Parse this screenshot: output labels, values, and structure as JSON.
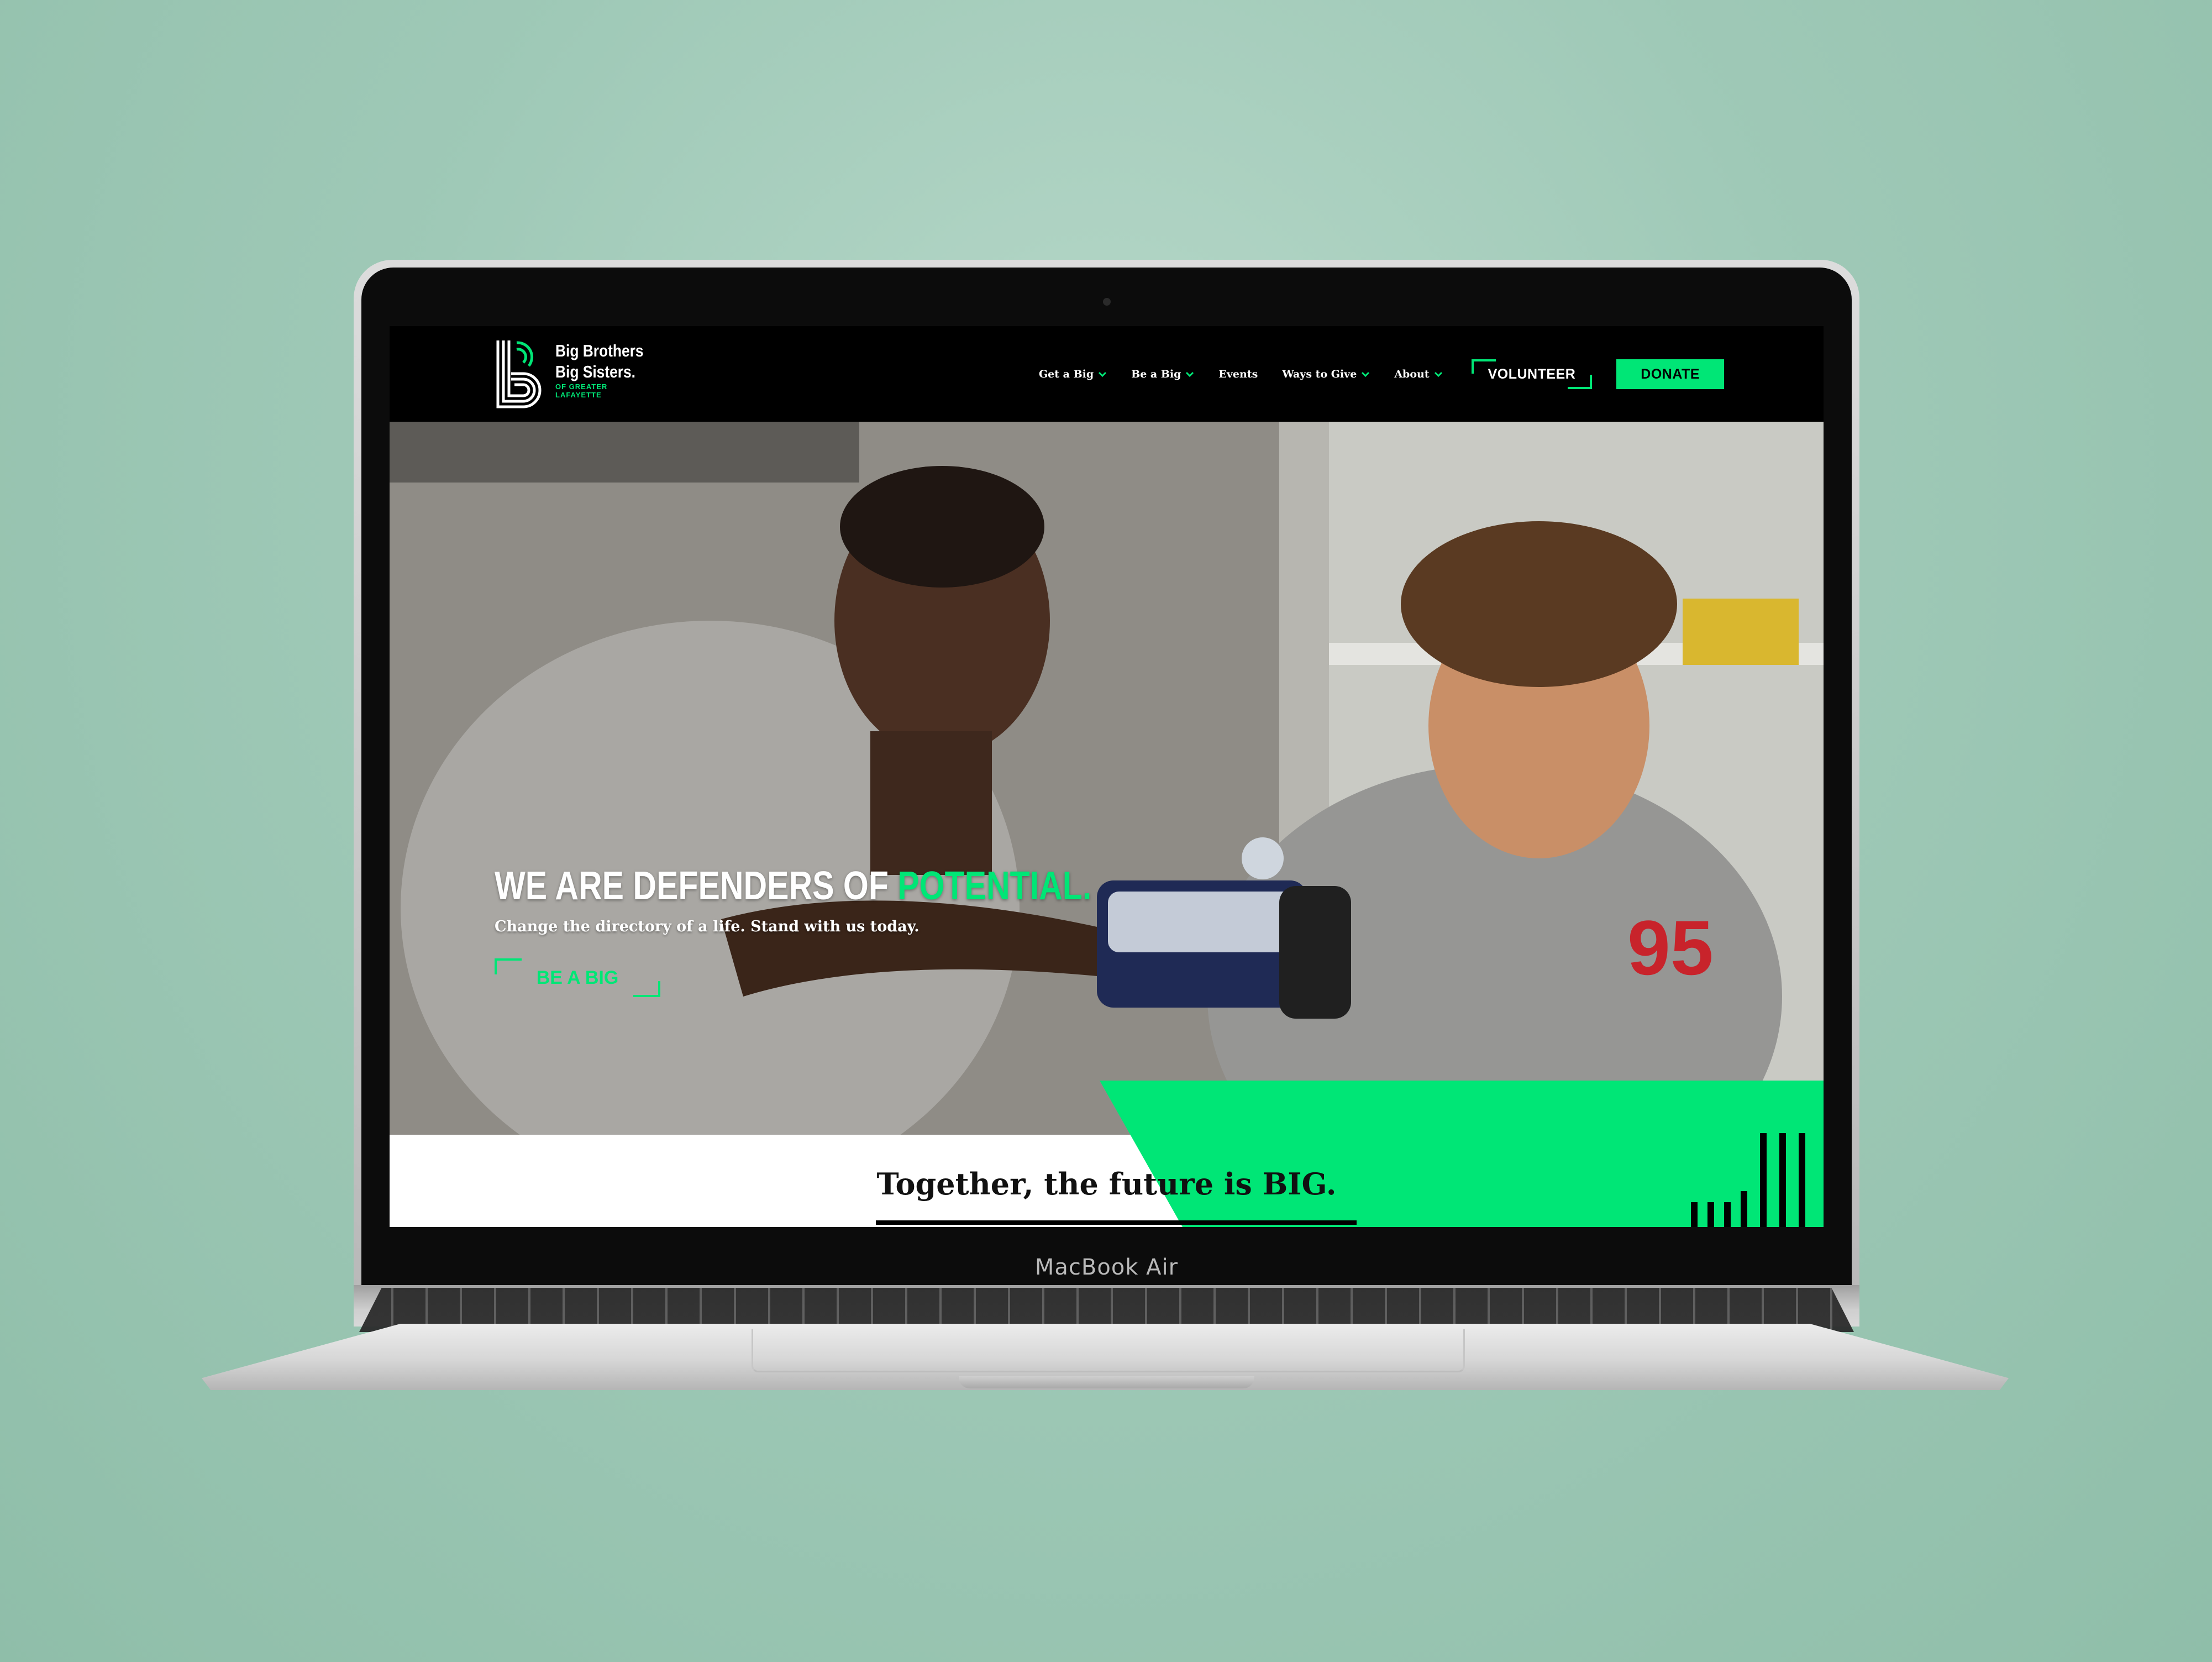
{
  "device": {
    "label": "MacBook Air"
  },
  "site": {
    "logo": {
      "line1": "Big Brothers",
      "line2": "Big Sisters.",
      "sub1": "OF GREATER",
      "sub2": "LAFAYETTE"
    },
    "nav": {
      "items": [
        {
          "label": "Get a Big",
          "has_dropdown": true
        },
        {
          "label": "Be a Big",
          "has_dropdown": true
        },
        {
          "label": "Events",
          "has_dropdown": false
        },
        {
          "label": "Ways to Give",
          "has_dropdown": true
        },
        {
          "label": "About",
          "has_dropdown": true
        }
      ],
      "volunteer_label": "VOLUNTEER",
      "donate_label": "DONATE"
    },
    "hero": {
      "heading_main": "WE ARE DEFENDERS OF ",
      "heading_accent": "POTENTIAL.",
      "subheading": "Change the directory of a life. Stand with us today.",
      "cta_label": "BE A BIG"
    },
    "band": {
      "tagline": "Together, the future is BIG."
    }
  },
  "colors": {
    "accent_green": "#00e676",
    "header_bg": "#000000",
    "background": "#a7cfbe"
  }
}
